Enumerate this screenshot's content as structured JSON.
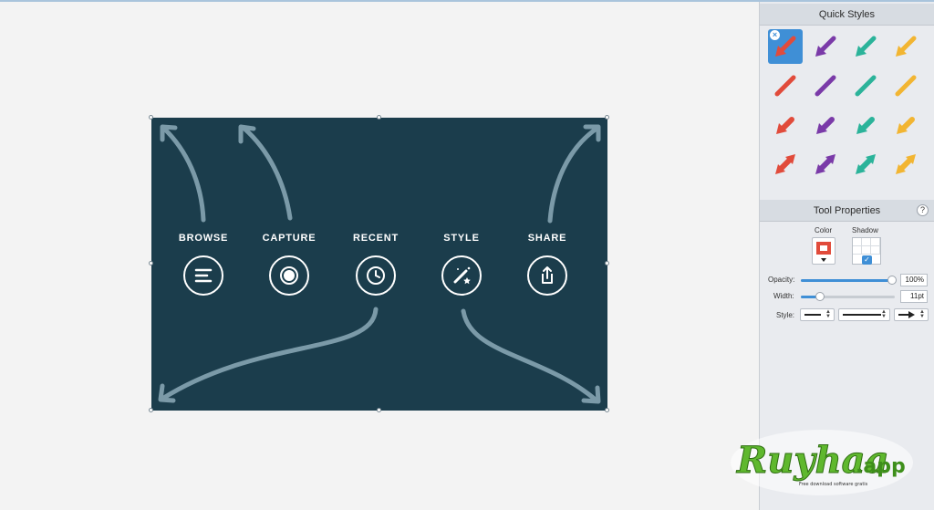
{
  "canvas": {
    "labels": [
      {
        "id": "browse",
        "text": "BROWSE",
        "icon": "menu-lines-icon"
      },
      {
        "id": "capture",
        "text": "CAPTURE",
        "icon": "record-dot-icon"
      },
      {
        "id": "recent",
        "text": "RECENT",
        "icon": "clock-icon"
      },
      {
        "id": "style",
        "text": "STYLE",
        "icon": "magic-wand-icon"
      },
      {
        "id": "share",
        "text": "SHARE",
        "icon": "share-upload-icon"
      }
    ],
    "background": "#1b3d4c",
    "arrow_color": "#7b9aa8"
  },
  "sidebar": {
    "quick_styles_title": "Quick Styles",
    "tool_properties_title": "Tool Properties",
    "help_label": "?",
    "style_colors": [
      "#e14b3b",
      "#7a3aa8",
      "#2bb39a",
      "#f2b532"
    ],
    "color_label": "Color",
    "shadow_label": "Shadow",
    "opacity_label": "Opacity:",
    "opacity_value": "100%",
    "opacity_fraction": 1.0,
    "width_label": "Width:",
    "width_value": "11pt",
    "width_fraction": 0.2,
    "style_label": "Style:",
    "shadow_checked": true
  },
  "logo": {
    "text": "Ruyhaa.app",
    "tagline": "Free download software gratis"
  }
}
